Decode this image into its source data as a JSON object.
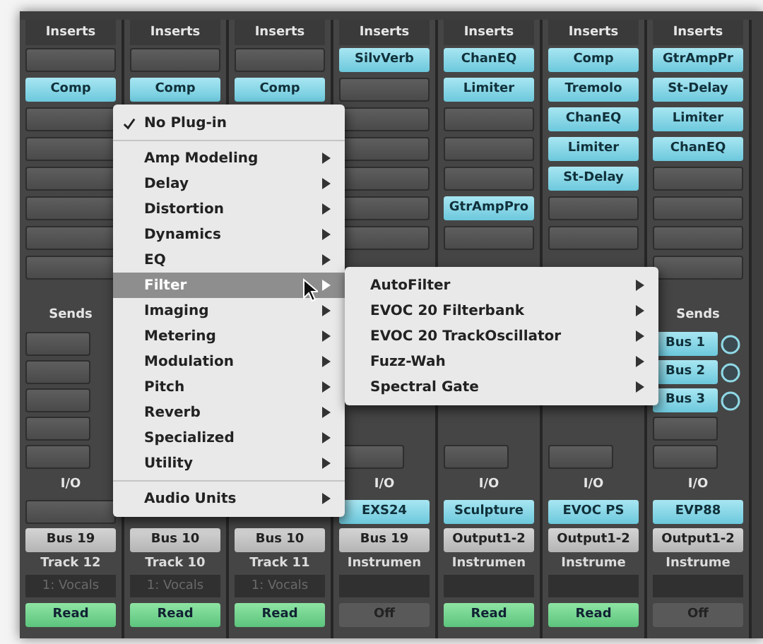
{
  "channels": [
    {
      "inserts_label": "Inserts",
      "inserts": [
        {
          "kind": "empty"
        },
        {
          "kind": "plugin",
          "name": "Comp"
        },
        {
          "kind": "empty"
        },
        {
          "kind": "empty"
        },
        {
          "kind": "empty"
        },
        {
          "kind": "empty"
        },
        {
          "kind": "empty"
        },
        {
          "kind": "empty"
        }
      ],
      "sends_label": "Sends",
      "sends": [
        {
          "kind": "empty"
        },
        {
          "kind": "empty"
        },
        {
          "kind": "empty"
        },
        {
          "kind": "empty"
        },
        {
          "kind": "empty"
        }
      ],
      "io_label": "I/O",
      "input": {
        "kind": "empty"
      },
      "output": "Bus 19",
      "name": "Track 12",
      "group": "1: Vocals",
      "automation": {
        "label": "Read",
        "kind": "read"
      }
    },
    {
      "inserts_label": "Inserts",
      "inserts": [
        {
          "kind": "empty"
        },
        {
          "kind": "plugin",
          "name": "Comp"
        }
      ],
      "output": "Bus 10",
      "name": "Track 10",
      "group": "1: Vocals",
      "automation": {
        "label": "Read",
        "kind": "read"
      }
    },
    {
      "inserts_label": "Inserts",
      "inserts": [
        {
          "kind": "empty"
        },
        {
          "kind": "plugin",
          "name": "Comp"
        }
      ],
      "output": "Bus 10",
      "name": "Track 11",
      "group": "1: Vocals",
      "automation": {
        "label": "Read",
        "kind": "read"
      }
    },
    {
      "inserts_label": "Inserts",
      "inserts": [
        {
          "kind": "plugin",
          "name": "SilvVerb"
        },
        {
          "kind": "empty"
        },
        {
          "kind": "empty"
        },
        {
          "kind": "empty"
        },
        {
          "kind": "empty"
        },
        {
          "kind": "empty"
        },
        {
          "kind": "empty"
        }
      ],
      "sends": [
        {
          "kind": "empty"
        }
      ],
      "io_label": "I/O",
      "input": {
        "kind": "plugin",
        "name": "EXS24"
      },
      "output": "Bus 19",
      "name": "Instrumen",
      "automation": {
        "label": "Off",
        "kind": "off"
      }
    },
    {
      "inserts_label": "Inserts",
      "inserts": [
        {
          "kind": "plugin",
          "name": "ChanEQ"
        },
        {
          "kind": "plugin",
          "name": "Limiter"
        },
        {
          "kind": "empty"
        },
        {
          "kind": "empty"
        },
        {
          "kind": "empty"
        },
        {
          "kind": "plugin",
          "name": "GtrAmpPro"
        },
        {
          "kind": "empty"
        }
      ],
      "sends": [
        {
          "kind": "empty"
        }
      ],
      "io_label": "I/O",
      "input": {
        "kind": "plugin",
        "name": "Sculpture"
      },
      "output": "Output1-2",
      "name": "Instrumen",
      "automation": {
        "label": "Read",
        "kind": "read"
      }
    },
    {
      "inserts_label": "Inserts",
      "inserts": [
        {
          "kind": "plugin",
          "name": "Comp"
        },
        {
          "kind": "plugin",
          "name": "Tremolo"
        },
        {
          "kind": "plugin",
          "name": "ChanEQ"
        },
        {
          "kind": "plugin",
          "name": "Limiter"
        },
        {
          "kind": "plugin",
          "name": "St-Delay"
        },
        {
          "kind": "empty"
        },
        {
          "kind": "empty"
        }
      ],
      "sends": [
        {
          "kind": "empty"
        }
      ],
      "io_label": "I/O",
      "input": {
        "kind": "plugin",
        "name": "EVOC PS"
      },
      "output": "Output1-2",
      "name": "Instrume",
      "automation": {
        "label": "Read",
        "kind": "read"
      }
    },
    {
      "inserts_label": "Inserts",
      "inserts": [
        {
          "kind": "plugin",
          "name": "GtrAmpPr"
        },
        {
          "kind": "plugin",
          "name": "St-Delay"
        },
        {
          "kind": "plugin",
          "name": "Limiter"
        },
        {
          "kind": "plugin",
          "name": "ChanEQ"
        },
        {
          "kind": "empty"
        },
        {
          "kind": "empty"
        },
        {
          "kind": "empty"
        },
        {
          "kind": "empty"
        }
      ],
      "sends_label": "Sends",
      "sends": [
        {
          "kind": "bus",
          "name": "Bus 1"
        },
        {
          "kind": "bus",
          "name": "Bus 2"
        },
        {
          "kind": "bus",
          "name": "Bus 3"
        },
        {
          "kind": "empty"
        },
        {
          "kind": "empty"
        }
      ],
      "io_label": "I/O",
      "input": {
        "kind": "plugin",
        "name": "EVP88"
      },
      "output": "Output1-2",
      "name": "Instrume",
      "automation": {
        "label": "Off",
        "kind": "off"
      }
    }
  ],
  "menu": {
    "items": [
      {
        "kind": "item",
        "label": "No Plug-in",
        "checked": true,
        "selected": false,
        "submenu": false
      },
      {
        "kind": "separator"
      },
      {
        "kind": "item",
        "label": "Amp Modeling",
        "checked": false,
        "selected": false,
        "submenu": true
      },
      {
        "kind": "item",
        "label": "Delay",
        "checked": false,
        "selected": false,
        "submenu": true
      },
      {
        "kind": "item",
        "label": "Distortion",
        "checked": false,
        "selected": false,
        "submenu": true
      },
      {
        "kind": "item",
        "label": "Dynamics",
        "checked": false,
        "selected": false,
        "submenu": true
      },
      {
        "kind": "item",
        "label": "EQ",
        "checked": false,
        "selected": false,
        "submenu": true
      },
      {
        "kind": "item",
        "label": "Filter",
        "checked": false,
        "selected": true,
        "submenu": true
      },
      {
        "kind": "item",
        "label": "Imaging",
        "checked": false,
        "selected": false,
        "submenu": true
      },
      {
        "kind": "item",
        "label": "Metering",
        "checked": false,
        "selected": false,
        "submenu": true
      },
      {
        "kind": "item",
        "label": "Modulation",
        "checked": false,
        "selected": false,
        "submenu": true
      },
      {
        "kind": "item",
        "label": "Pitch",
        "checked": false,
        "selected": false,
        "submenu": true
      },
      {
        "kind": "item",
        "label": "Reverb",
        "checked": false,
        "selected": false,
        "submenu": true
      },
      {
        "kind": "item",
        "label": "Specialized",
        "checked": false,
        "selected": false,
        "submenu": true
      },
      {
        "kind": "item",
        "label": "Utility",
        "checked": false,
        "selected": false,
        "submenu": true
      },
      {
        "kind": "separator"
      },
      {
        "kind": "item",
        "label": "Audio Units",
        "checked": false,
        "selected": false,
        "submenu": true
      }
    ]
  },
  "submenu": {
    "items": [
      {
        "label": "AutoFilter",
        "submenu": true
      },
      {
        "label": "EVOC 20 Filterbank",
        "submenu": true
      },
      {
        "label": "EVOC 20 TrackOscillator",
        "submenu": true
      },
      {
        "label": "Fuzz-Wah",
        "submenu": true
      },
      {
        "label": "Spectral Gate",
        "submenu": true
      }
    ]
  }
}
